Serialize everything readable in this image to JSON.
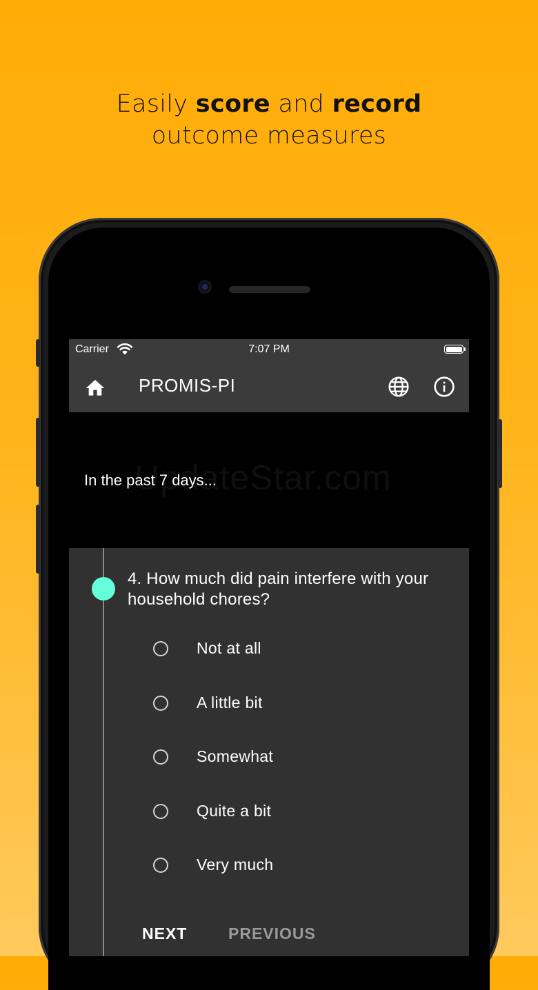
{
  "promo": {
    "line1_pre": "Easily ",
    "line1_bold1": "score",
    "line1_mid": " and ",
    "line1_bold2": "record",
    "line2": "outcome measures"
  },
  "status_bar": {
    "carrier": "Carrier",
    "time": "7:07 PM"
  },
  "app_bar": {
    "title": "PROMIS-PI",
    "icons": [
      "home-icon",
      "globe-icon",
      "info-icon"
    ]
  },
  "intro_text": "In the past 7 days...",
  "watermark": "UpdateStar.com",
  "question": {
    "text": "4. How much did pain interfere with your household chores?",
    "options": [
      {
        "label": "Not at all"
      },
      {
        "label": "A little bit"
      },
      {
        "label": "Somewhat"
      },
      {
        "label": "Quite a bit"
      },
      {
        "label": "Very much"
      }
    ]
  },
  "actions": {
    "next": "NEXT",
    "previous": "PREVIOUS"
  },
  "colors": {
    "background": "#FFAC07",
    "accent": "#64FFDA",
    "appbar": "#3B3B3B",
    "card": "#313131"
  }
}
